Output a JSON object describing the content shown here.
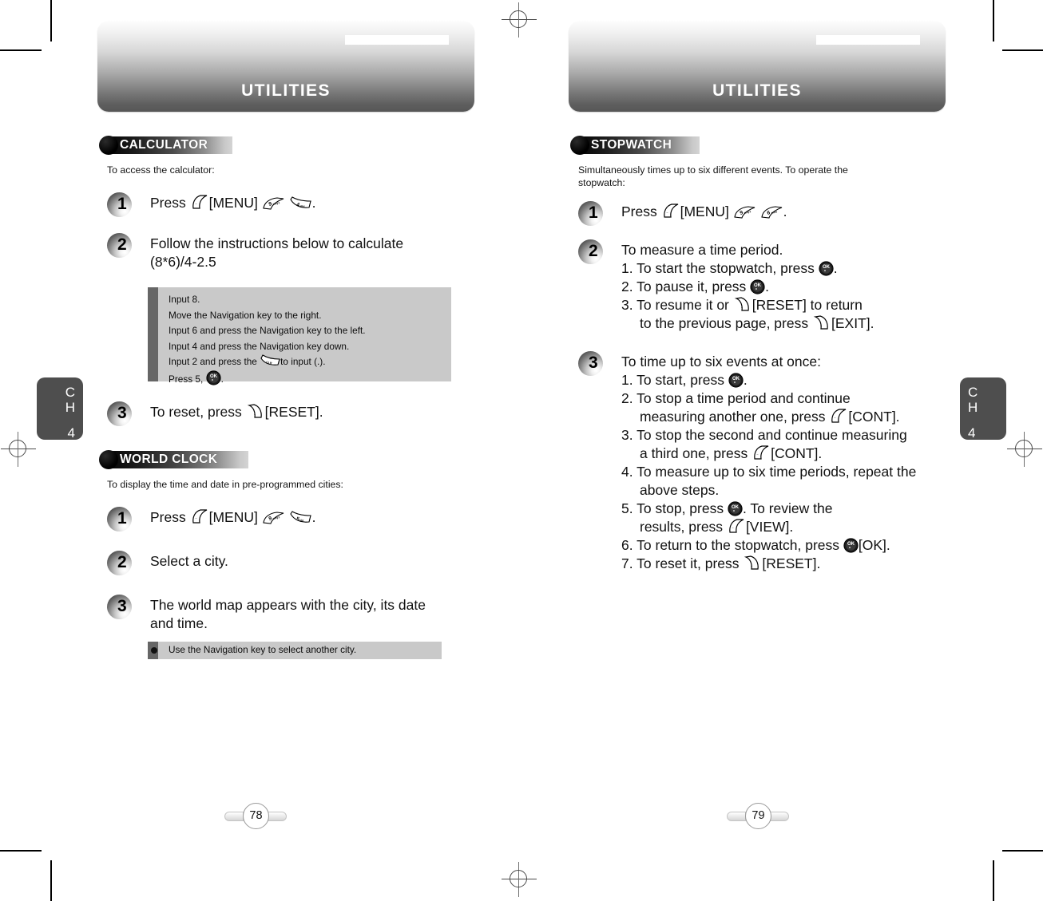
{
  "document": {
    "left_page": {
      "banner_title": "UTILITIES",
      "page_number": "78",
      "chapter_tab": {
        "c": "C",
        "h": "H",
        "number": "4"
      },
      "sections": [
        {
          "badge": "CALCULATOR",
          "intro": "To access the calculator:",
          "steps": [
            {
              "number": "1",
              "text_before": "Press",
              "text_mid": "[MENU]",
              "text_after": "."
            },
            {
              "number": "2",
              "line1": "Follow the instructions below to calculate",
              "line2": "(8*6)/4-2.5"
            },
            {
              "number": "3",
              "text_before": "To reset, press",
              "text_after": "[RESET]."
            }
          ],
          "note": {
            "lines": [
              "Input 8.",
              "Move the Navigation key to the right.",
              "Input 6 and press the Navigation key to the left.",
              "Input 4 and press the Navigation key down.",
              "Input 2 and press the",
              "Press 5,"
            ],
            "line5_tail": "to input (.).",
            "line6_tail": "."
          }
        },
        {
          "badge": "WORLD CLOCK",
          "intro": "To display the time and date in pre-programmed cities:",
          "steps": [
            {
              "number": "1",
              "text_before": "Press",
              "text_mid": "[MENU]",
              "text_after": "."
            },
            {
              "number": "2",
              "text": "Select a city."
            },
            {
              "number": "3",
              "line1": "The world map appears with the city, its date",
              "line2": "and time."
            }
          ],
          "note": {
            "bullet_text": "Use the Navigation key to select another city."
          }
        }
      ]
    },
    "right_page": {
      "banner_title": "UTILITIES",
      "page_number": "79",
      "chapter_tab": {
        "c": "C",
        "h": "H",
        "number": "4"
      },
      "sections": [
        {
          "badge": "STOPWATCH",
          "intro_line1": "Simultaneously times up to six different events. To operate the",
          "intro_line2": "stopwatch:",
          "steps": [
            {
              "number": "1",
              "text_before": "Press",
              "text_mid": "[MENU]",
              "text_after": "."
            },
            {
              "number": "2",
              "heading": "To measure a time period.",
              "items": [
                {
                  "pre": "1. To start the stopwatch, press",
                  "post": "."
                },
                {
                  "pre": "2. To pause it, press",
                  "post": "."
                },
                {
                  "pre": "3. To resume it or",
                  "post": "[RESET] to return"
                },
                {
                  "pre": "to the previous page, press",
                  "post": "[EXIT].",
                  "indent": true
                }
              ]
            },
            {
              "number": "3",
              "heading": "To time up to six events at once:",
              "items": [
                {
                  "pre": "1. To start, press",
                  "post": "."
                },
                {
                  "pre": "2. To stop a time period and continue",
                  "post": ""
                },
                {
                  "pre": "measuring another one, press",
                  "post": "[CONT].",
                  "indent": true
                },
                {
                  "pre": "3. To stop the second and continue measuring",
                  "post": ""
                },
                {
                  "pre": "a third one, press",
                  "post": "[CONT].",
                  "indent": true
                },
                {
                  "pre": "4. To measure up to six time periods, repeat the",
                  "post": ""
                },
                {
                  "pre": "above steps.",
                  "post": "",
                  "indent": true
                },
                {
                  "pre": "5. To stop, press",
                  "post": ". To review the"
                },
                {
                  "pre": "results, press",
                  "post": "[VIEW].",
                  "indent": true
                },
                {
                  "pre": "6. To return to the stopwatch, press",
                  "post": "[OK]."
                },
                {
                  "pre": "7. To reset it, press",
                  "post": "[RESET]."
                }
              ]
            }
          ]
        }
      ]
    },
    "keys": {
      "soft_left": "left-softkey",
      "soft_right": "right-softkey",
      "nine": "9",
      "nine_sub": "wxyz",
      "four": "4",
      "four_sub": "ghi",
      "five": "5",
      "five_sub": "jkl",
      "six": "6",
      "six_sub": "mno",
      "clear": "CLR",
      "ok": "OK"
    },
    "colors": {
      "banner_dark": "#565656",
      "banner_light": "#fdfdfd",
      "badge_dark": "#050505",
      "note_bg": "#c9c9c9",
      "note_tab": "#666666",
      "tab_gray": "#4e4e4e"
    }
  }
}
